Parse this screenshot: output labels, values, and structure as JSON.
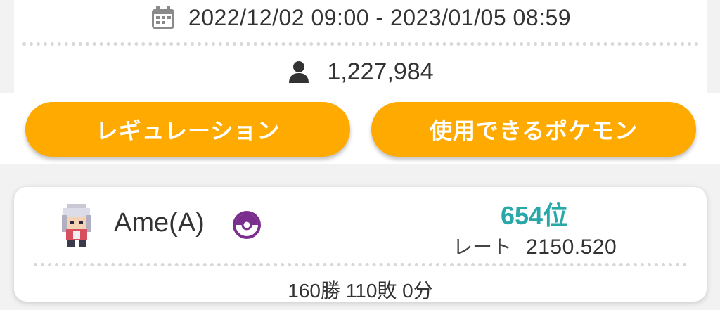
{
  "season": {
    "period": "2022/12/02 09:00 - 2023/01/05 08:59",
    "participants": "1,227,984",
    "period_icon": "calendar-icon",
    "participants_icon": "person-icon"
  },
  "buttons": {
    "regulation_label": "レギュレーション",
    "usable_pokemon_label": "使用できるポケモン"
  },
  "player": {
    "name": "Ame(A)",
    "rank": "654位",
    "rate_label": "レート",
    "rate_value": "2150.520",
    "record": "160勝 110敗 0分",
    "ball_icon": "master-ball-icon"
  },
  "colors": {
    "accent": "#ffaa00",
    "rank": "#2aa8a8",
    "ball": "#7a2e8e"
  }
}
